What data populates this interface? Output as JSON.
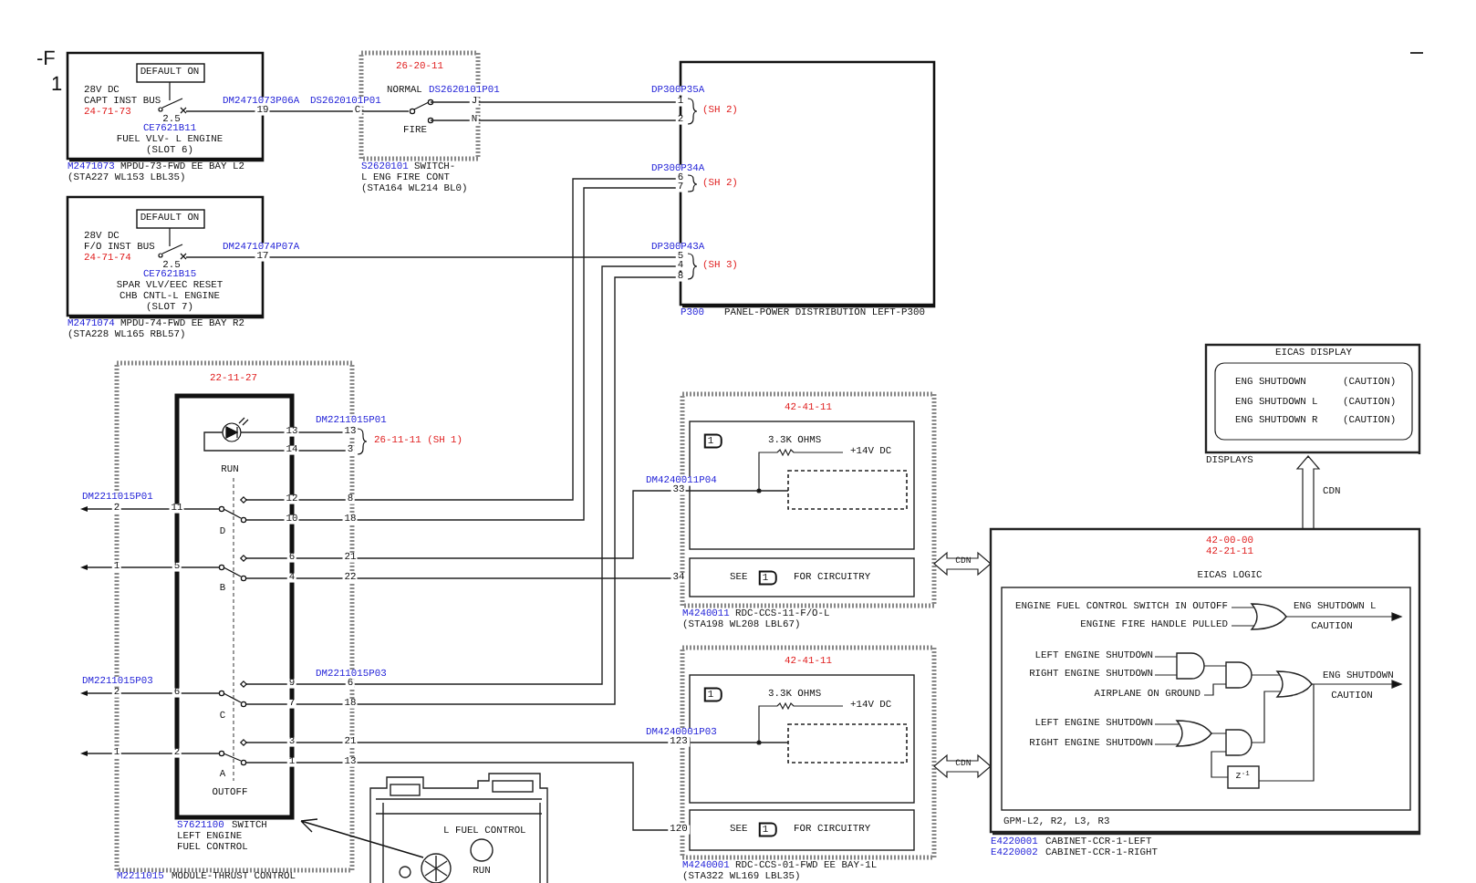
{
  "sheet_marker": {
    "labels": [
      {
        "kind": "marker",
        "text": "-F"
      },
      {
        "kind": "marker",
        "text": "1"
      }
    ]
  },
  "capt_breaker": {
    "labels": [
      {
        "kind": "note",
        "text": "DEFAULT ON"
      },
      {
        "kind": "note",
        "text": "28V DC"
      },
      {
        "kind": "note",
        "text": "CAPT INST BUS"
      },
      {
        "kind": "chapter",
        "text": "24-71-73"
      },
      {
        "kind": "note",
        "text": "2.5"
      },
      {
        "kind": "ref",
        "text": "CE7621B11"
      },
      {
        "kind": "note",
        "text": "FUEL VLV- L ENGINE"
      },
      {
        "kind": "note",
        "text": "(SLOT 6)"
      },
      {
        "kind": "ref",
        "text": "M2471073"
      },
      {
        "kind": "note",
        "text": "MPDU-73-FWD EE BAY L2"
      },
      {
        "kind": "note",
        "text": "(STA227 WL153 LBL35)"
      },
      {
        "kind": "ref",
        "text": "DM2471073P06A"
      },
      {
        "kind": "pin",
        "text": "19"
      }
    ]
  },
  "fo_breaker": {
    "labels": [
      {
        "kind": "note",
        "text": "DEFAULT ON"
      },
      {
        "kind": "note",
        "text": "28V DC"
      },
      {
        "kind": "note",
        "text": "F/O INST BUS"
      },
      {
        "kind": "chapter",
        "text": "24-71-74"
      },
      {
        "kind": "note",
        "text": "2.5"
      },
      {
        "kind": "ref",
        "text": "CE7621B15"
      },
      {
        "kind": "note",
        "text": "SPAR VLV/EEC RESET"
      },
      {
        "kind": "note",
        "text": "CHB CNTL-L ENGINE"
      },
      {
        "kind": "note",
        "text": "(SLOT 7)"
      },
      {
        "kind": "ref",
        "text": "M2471074"
      },
      {
        "kind": "note",
        "text": "MPDU-74-FWD EE BAY R2"
      },
      {
        "kind": "note",
        "text": "(STA228 WL165 RBL57)"
      },
      {
        "kind": "ref",
        "text": "DM2471074P07A"
      },
      {
        "kind": "pin",
        "text": "17"
      }
    ]
  },
  "fire_switch": {
    "labels": [
      {
        "kind": "chapter",
        "text": "26-20-11"
      },
      {
        "kind": "note",
        "text": "NORMAL"
      },
      {
        "kind": "ref",
        "text": "DS2620101P01"
      },
      {
        "kind": "ref",
        "text": "DS2620101P01"
      },
      {
        "kind": "pin",
        "text": "C"
      },
      {
        "kind": "pin",
        "text": "J"
      },
      {
        "kind": "pin",
        "text": "N"
      },
      {
        "kind": "note",
        "text": "FIRE"
      },
      {
        "kind": "ref",
        "text": "S2620101"
      },
      {
        "kind": "note",
        "text": "SWITCH-"
      },
      {
        "kind": "note",
        "text": "L ENG FIRE CONT"
      },
      {
        "kind": "note",
        "text": "(STA164 WL214 BL0)"
      }
    ]
  },
  "panel_p300": {
    "labels": [
      {
        "kind": "ref",
        "text": "DP300P35A"
      },
      {
        "kind": "pin",
        "text": "1"
      },
      {
        "kind": "pin",
        "text": "2"
      },
      {
        "kind": "chapter",
        "text": "(SH 2)"
      },
      {
        "kind": "ref",
        "text": "DP300P34A"
      },
      {
        "kind": "pin",
        "text": "6"
      },
      {
        "kind": "pin",
        "text": "7"
      },
      {
        "kind": "chapter",
        "text": "(SH 2)"
      },
      {
        "kind": "ref",
        "text": "DP300P43A"
      },
      {
        "kind": "pin",
        "text": "5"
      },
      {
        "kind": "pin",
        "text": "4"
      },
      {
        "kind": "pin",
        "text": "8"
      },
      {
        "kind": "chapter",
        "text": "(SH 3)"
      },
      {
        "kind": "ref",
        "text": "P300"
      },
      {
        "kind": "note",
        "text": "PANEL-POWER DISTRIBUTION LEFT-P300"
      }
    ]
  },
  "fuel_control_switch": {
    "labels": [
      {
        "kind": "chapter",
        "text": "22-11-27"
      },
      {
        "kind": "pin",
        "text": "13"
      },
      {
        "kind": "pin",
        "text": "14"
      },
      {
        "kind": "ref",
        "text": "DM2211015P01"
      },
      {
        "kind": "pin",
        "text": "13"
      },
      {
        "kind": "pin",
        "text": "3"
      },
      {
        "kind": "chapter",
        "text": "26-11-11 (SH 1)"
      },
      {
        "kind": "note",
        "text": "RUN"
      },
      {
        "kind": "ref",
        "text": "DM2211015P01"
      },
      {
        "kind": "pin",
        "text": "2"
      },
      {
        "kind": "pin",
        "text": "11"
      },
      {
        "kind": "pin",
        "text": "12"
      },
      {
        "kind": "pin",
        "text": "8"
      },
      {
        "kind": "pin",
        "text": "10"
      },
      {
        "kind": "pin",
        "text": "18"
      },
      {
        "kind": "note",
        "text": "D"
      },
      {
        "kind": "pin",
        "text": "1"
      },
      {
        "kind": "pin",
        "text": "5"
      },
      {
        "kind": "pin",
        "text": "6"
      },
      {
        "kind": "pin",
        "text": "21"
      },
      {
        "kind": "pin",
        "text": "4"
      },
      {
        "kind": "pin",
        "text": "22"
      },
      {
        "kind": "note",
        "text": "B"
      },
      {
        "kind": "ref",
        "text": "DM2211015P03"
      },
      {
        "kind": "ref",
        "text": "DM2211015P03"
      },
      {
        "kind": "pin",
        "text": "2"
      },
      {
        "kind": "pin",
        "text": "6"
      },
      {
        "kind": "pin",
        "text": "9"
      },
      {
        "kind": "pin",
        "text": "6"
      },
      {
        "kind": "pin",
        "text": "7"
      },
      {
        "kind": "pin",
        "text": "18"
      },
      {
        "kind": "note",
        "text": "C"
      },
      {
        "kind": "pin",
        "text": "1"
      },
      {
        "kind": "pin",
        "text": "2"
      },
      {
        "kind": "pin",
        "text": "3"
      },
      {
        "kind": "pin",
        "text": "21"
      },
      {
        "kind": "pin",
        "text": "1"
      },
      {
        "kind": "pin",
        "text": "13"
      },
      {
        "kind": "note",
        "text": "A"
      },
      {
        "kind": "note",
        "text": "OUTOFF"
      },
      {
        "kind": "ref",
        "text": "S7621100"
      },
      {
        "kind": "note",
        "text": "SWITCH"
      },
      {
        "kind": "note",
        "text": "LEFT ENGINE"
      },
      {
        "kind": "note",
        "text": "FUEL CONTROL"
      },
      {
        "kind": "ref",
        "text": "M2211015"
      },
      {
        "kind": "note",
        "text": "MODULE-THRUST CONTROL"
      }
    ]
  },
  "control_panel_drawing": {
    "labels": [
      {
        "kind": "note",
        "text": "L FUEL CONTROL"
      },
      {
        "kind": "note",
        "text": "RUN"
      }
    ]
  },
  "rdc_upper": {
    "labels": [
      {
        "kind": "chapter",
        "text": "42-41-11"
      },
      {
        "kind": "tag",
        "text": "1"
      },
      {
        "kind": "note",
        "text": "3.3K OHMS"
      },
      {
        "kind": "note",
        "text": "+14V DC"
      },
      {
        "kind": "ref",
        "text": "DM4240011P04"
      },
      {
        "kind": "pin",
        "text": "33"
      },
      {
        "kind": "pin",
        "text": "34"
      },
      {
        "kind": "note",
        "text": "SEE"
      },
      {
        "kind": "tag",
        "text": "1"
      },
      {
        "kind": "note",
        "text": "FOR CIRCUITRY"
      },
      {
        "kind": "ref",
        "text": "M4240011"
      },
      {
        "kind": "note",
        "text": "RDC-CCS-11-F/O-L"
      },
      {
        "kind": "note",
        "text": "(STA198 WL208 LBL67)"
      },
      {
        "kind": "bus",
        "text": "CDN"
      }
    ]
  },
  "rdc_lower": {
    "labels": [
      {
        "kind": "chapter",
        "text": "42-41-11"
      },
      {
        "kind": "tag",
        "text": "1"
      },
      {
        "kind": "note",
        "text": "3.3K OHMS"
      },
      {
        "kind": "note",
        "text": "+14V DC"
      },
      {
        "kind": "ref",
        "text": "DM4240001P03"
      },
      {
        "kind": "pin",
        "text": "123"
      },
      {
        "kind": "pin",
        "text": "120"
      },
      {
        "kind": "note",
        "text": "SEE"
      },
      {
        "kind": "tag",
        "text": "1"
      },
      {
        "kind": "note",
        "text": "FOR CIRCUITRY"
      },
      {
        "kind": "ref",
        "text": "M4240001"
      },
      {
        "kind": "note",
        "text": "RDC-CCS-01-FWD EE BAY-1L"
      },
      {
        "kind": "note",
        "text": "(STA322 WL169 LBL35)"
      },
      {
        "kind": "bus",
        "text": "CDN"
      }
    ]
  },
  "eicas_display": {
    "labels": [
      {
        "kind": "note",
        "text": "EICAS DISPLAY"
      },
      {
        "kind": "note",
        "text": "ENG SHUTDOWN"
      },
      {
        "kind": "note",
        "text": "(CAUTION)"
      },
      {
        "kind": "note",
        "text": "ENG SHUTDOWN L"
      },
      {
        "kind": "note",
        "text": "(CAUTION)"
      },
      {
        "kind": "note",
        "text": "ENG SHUTDOWN R"
      },
      {
        "kind": "note",
        "text": "(CAUTION)"
      },
      {
        "kind": "note",
        "text": "DISPLAYS"
      },
      {
        "kind": "note",
        "text": "CDN"
      }
    ]
  },
  "common_core_cabinet": {
    "labels": [
      {
        "kind": "chapter",
        "text": "42-00-00"
      },
      {
        "kind": "chapter",
        "text": "42-21-11"
      },
      {
        "kind": "note",
        "text": "EICAS LOGIC"
      },
      {
        "kind": "note",
        "text": "ENGINE FUEL CONTROL SWITCH IN OUTOFF"
      },
      {
        "kind": "note",
        "text": "ENGINE FIRE HANDLE PULLED"
      },
      {
        "kind": "note",
        "text": "ENG SHUTDOWN L"
      },
      {
        "kind": "note",
        "text": "CAUTION"
      },
      {
        "kind": "note",
        "text": "LEFT ENGINE SHUTDOWN"
      },
      {
        "kind": "note",
        "text": "RIGHT ENGINE SHUTDOWN"
      },
      {
        "kind": "note",
        "text": "AIRPLANE ON GROUND"
      },
      {
        "kind": "note",
        "text": "ENG SHUTDOWN"
      },
      {
        "kind": "note",
        "text": "CAUTION"
      },
      {
        "kind": "note",
        "text": "LEFT ENGINE SHUTDOWN"
      },
      {
        "kind": "note",
        "text": "RIGHT ENGINE SHUTDOWN"
      },
      {
        "kind": "note",
        "text": "z$^{-1}$"
      },
      {
        "kind": "note",
        "text": "GPM-L2, R2, L3, R3"
      },
      {
        "kind": "ref",
        "text": "E4220001"
      },
      {
        "kind": "note",
        "text": "CABINET-CCR-1-LEFT"
      },
      {
        "kind": "ref",
        "text": "E4220002"
      },
      {
        "kind": "note",
        "text": "CABINET-CCR-1-RIGHT"
      }
    ]
  }
}
